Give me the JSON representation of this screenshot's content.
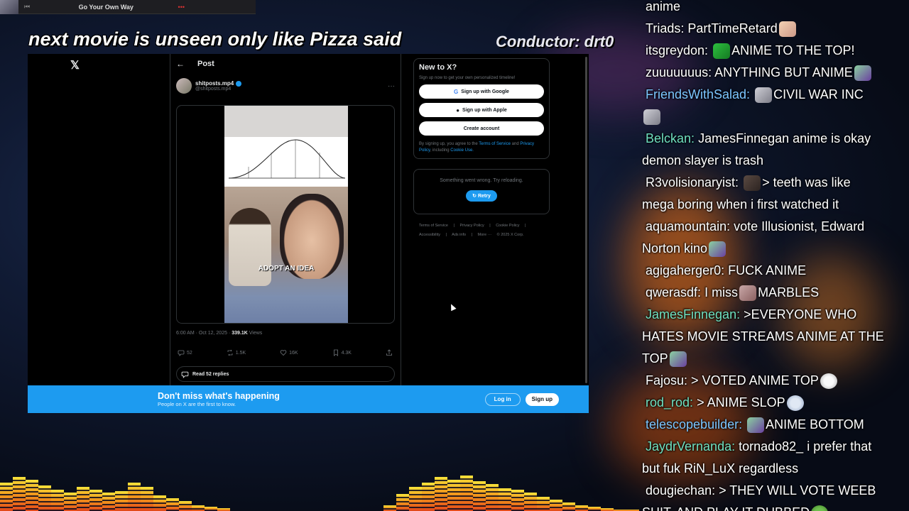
{
  "media_player": {
    "title": "Go Your Own Way"
  },
  "overlay": {
    "caption": "next movie is unseen only like Pizza said",
    "conductor": "Conductor: drt0"
  },
  "x": {
    "logo": "𝕏",
    "post": {
      "header": "Post",
      "author_name": "shitposts.mp4",
      "author_handle": "@shitposts.mp4",
      "video_caption": "ADOPT AN IDEA",
      "timestamp": "6:00 AM · Oct 12, 2025 ·",
      "views_count": "339.1K",
      "views_label": "Views",
      "replies": "52",
      "reposts": "1.5K",
      "likes": "16K",
      "bookmarks": "4.3K",
      "read_replies": "Read 52 replies"
    },
    "sidebar": {
      "new_title": "New to X?",
      "new_sub": "Sign up now to get your own personalized timeline!",
      "google_btn": "Sign up with Google",
      "apple_btn": "Sign up with Apple",
      "create_btn": "Create account",
      "legal_prefix": "By signing up, you agree to the",
      "terms": "Terms of Service",
      "and": "and",
      "privacy": "Privacy Policy",
      "including": ", including",
      "cookie": "Cookie Use.",
      "error_text": "Something went wrong. Try reloading.",
      "retry": "Retry",
      "footer": [
        "Terms of Service",
        "|",
        "Privacy Policy",
        "|",
        "Cookie Policy",
        "|",
        "Accessibility",
        "|",
        "Ads info",
        "|",
        "More ···",
        "© 2025 X Corp."
      ]
    },
    "banner": {
      "title": "Don't miss what's happening",
      "subtitle": "People on X are the first to know.",
      "login": "Log in",
      "signup": "Sign up"
    }
  },
  "chat": [
    {
      "user": "anime",
      "color": "#ffffff",
      "msg": ""
    },
    {
      "user": "Triads:",
      "color": "#ffffff",
      "msg": "PartTimeRetard",
      "emote": "e-cat"
    },
    {
      "user": "itsgreydon:",
      "color": "#ffffff",
      "msg": "ANIME TO THE TOP!",
      "emote_before": "e-green"
    },
    {
      "user": "zuuuuuuus:",
      "color": "#ffffff",
      "msg": "ANYTHING BUT ANIME",
      "emote": "e-witch"
    },
    {
      "user": "FriendsWithSalad:",
      "color": "#7cc6ff",
      "msg": "CIVIL WAR INC",
      "emote_before": "e-gray"
    },
    {
      "user": "",
      "color": "#ffffff",
      "msg": "",
      "emote": "e-gray"
    },
    {
      "user": "Belckan:",
      "color": "#6fe0c0",
      "msg": "JamesFinnegan anime is okay"
    },
    {
      "user": "",
      "color": "#ffffff",
      "msg": "demon slayer is trash"
    },
    {
      "user": "R3volisionaryist:",
      "color": "#ffffff",
      "msg": "> teeth was like",
      "emote_mid": "e-dark"
    },
    {
      "user": "",
      "color": "#ffffff",
      "msg": "mega boring when i first watched it"
    },
    {
      "user": "aquamountain:",
      "color": "#ffffff",
      "msg": "vote Illusionist, Edward"
    },
    {
      "user": "",
      "color": "#ffffff",
      "msg": "Norton kino",
      "emote": "e-witch"
    },
    {
      "user": "agigaherger0:",
      "color": "#ffffff",
      "msg": "FUCK ANIME"
    },
    {
      "user": "qwerasdf:",
      "color": "#ffffff",
      "msg": "I miss",
      "emote": "e-pink",
      "msg2": "MARBLES"
    },
    {
      "user": "JamesFinnegan:",
      "color": "#6fe0c0",
      "msg": ">EVERYONE WHO"
    },
    {
      "user": "",
      "color": "#ffffff",
      "msg": "HATES MOVIE STREAMS ANIME AT THE"
    },
    {
      "user": "",
      "color": "#ffffff",
      "msg": "TOP",
      "emote": "e-witch"
    },
    {
      "user": "Fajosu:",
      "color": "#ffffff",
      "msg": "> VOTED ANIME TOP",
      "emote": "e-troll"
    },
    {
      "user": "rod_rod:",
      "color": "#6fe0c0",
      "msg": "> ANIME SLOP",
      "emote": "e-ghost"
    },
    {
      "user": "telescopebuilder:",
      "color": "#7cc6ff",
      "msg": "ANIME BOTTOM",
      "emote_before": "e-witch"
    },
    {
      "user": "JaydrVernanda:",
      "color": "#6fe0c0",
      "msg": "tornado82_ i prefer that"
    },
    {
      "user": "",
      "color": "#ffffff",
      "msg": "but fuk RiN_LuX regardless"
    },
    {
      "user": "dougiechan:",
      "color": "#ffffff",
      "msg": "> THEY WILL VOTE WEEB"
    },
    {
      "user": "",
      "color": "#ffffff",
      "msg": "SHIT, AND PLAY IT DUBBED",
      "emote": "e-pepe"
    }
  ]
}
